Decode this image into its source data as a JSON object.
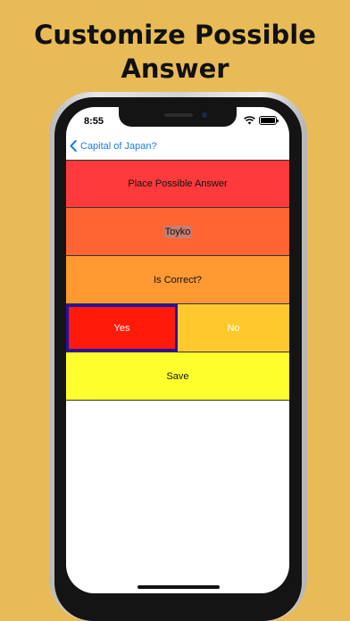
{
  "promo": {
    "headline_line1": "Customize Possible",
    "headline_line2": "Answer"
  },
  "status_bar": {
    "time": "8:55"
  },
  "nav": {
    "back_label": "Capital of Japan?",
    "back_icon": "chevron-left-icon"
  },
  "form": {
    "place_label": "Place Possible Answer",
    "answer_value": "Toyko",
    "correct_label": "Is Correct?",
    "yes_label": "Yes",
    "no_label": "No",
    "selected_option": "Yes",
    "save_label": "Save"
  },
  "colors": {
    "background": "#e8bb57",
    "row_place": "#ff3a3c",
    "row_answer": "#ff6433",
    "row_correct": "#ff9a32",
    "yes": "#ff1a0a",
    "yes_border": "#2211aa",
    "no": "#ffc92e",
    "save": "#ffff2e",
    "accent": "#1a7be6"
  }
}
